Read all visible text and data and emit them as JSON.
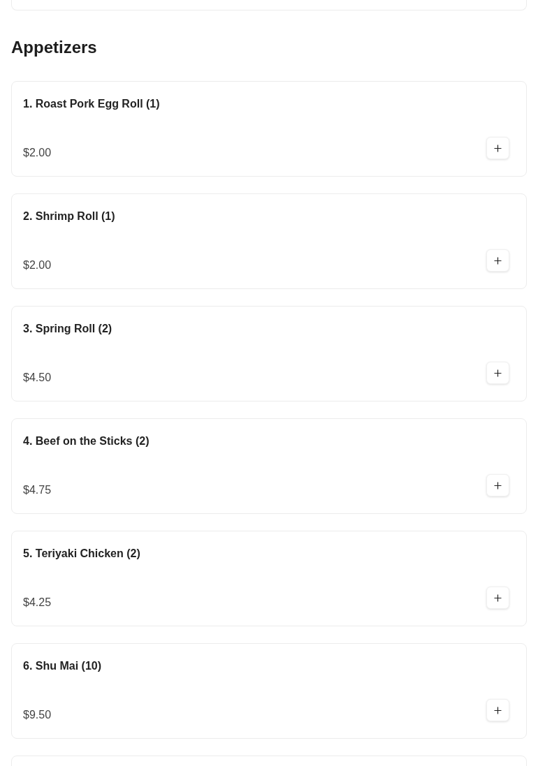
{
  "section": {
    "title": "Appetizers"
  },
  "items": [
    {
      "name": "1. Roast Pork Egg Roll (1)",
      "price": "$2.00"
    },
    {
      "name": "2. Shrimp Roll (1)",
      "price": "$2.00"
    },
    {
      "name": "3. Spring Roll (2)",
      "price": "$4.50"
    },
    {
      "name": "4. Beef on the Sticks (2)",
      "price": "$4.75"
    },
    {
      "name": "5. Teriyaki Chicken (2)",
      "price": "$4.25"
    },
    {
      "name": "6. Shu Mai (10)",
      "price": "$9.50"
    }
  ]
}
